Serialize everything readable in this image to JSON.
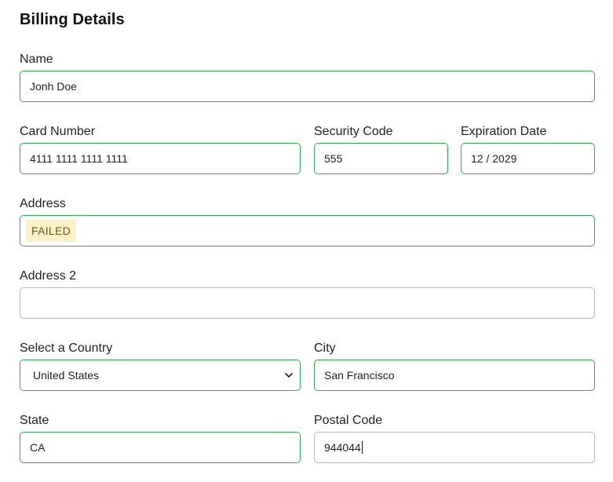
{
  "form": {
    "title": "Billing Details",
    "name": {
      "label": "Name",
      "value": "Jonh Doe"
    },
    "card_number": {
      "label": "Card Number",
      "value": "4111 1111 1111 1111"
    },
    "security_code": {
      "label": "Security Code",
      "value": "555"
    },
    "expiration_date": {
      "label": "Expiration Date",
      "value": "12 / 2029"
    },
    "address": {
      "label": "Address",
      "value": "FAILED"
    },
    "address2": {
      "label": "Address 2",
      "value": ""
    },
    "country": {
      "label": "Select a Country",
      "value": "United States",
      "icon": "chevron-down-icon"
    },
    "city": {
      "label": "City",
      "value": "San Francisco"
    },
    "state": {
      "label": "State",
      "value": "CA"
    },
    "postal_code": {
      "label": "Postal Code",
      "value": "944044"
    }
  },
  "colors": {
    "valid_border": "#2fae4e",
    "empty_border": "#b9b9b9",
    "failed_highlight": "#fbf0c7"
  }
}
